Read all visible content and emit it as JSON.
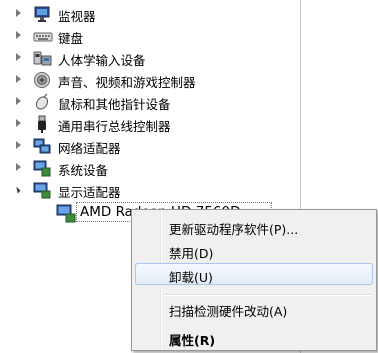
{
  "tree": {
    "items": [
      {
        "label": "监视器",
        "icon": "monitor-icon"
      },
      {
        "label": "键盘",
        "icon": "keyboard-icon"
      },
      {
        "label": "人体学输入设备",
        "icon": "hid-icon"
      },
      {
        "label": "声音、视频和游戏控制器",
        "icon": "speaker-icon"
      },
      {
        "label": "鼠标和其他指针设备",
        "icon": "mouse-icon"
      },
      {
        "label": "通用串行总线控制器",
        "icon": "usb-icon"
      },
      {
        "label": "网络适配器",
        "icon": "network-icon"
      },
      {
        "label": "系统设备",
        "icon": "system-device-icon"
      },
      {
        "label": "显示适配器",
        "icon": "display-adapter-icon"
      }
    ],
    "child": {
      "label": "AMD Radeon HD 7560D",
      "icon": "display-adapter-icon"
    }
  },
  "context_menu": {
    "items": [
      {
        "label": "更新驱动程序软件(P)..."
      },
      {
        "label": "禁用(D)"
      },
      {
        "label": "卸载(U)"
      },
      {
        "label": "扫描检测硬件改动(A)"
      },
      {
        "label": "属性(R)"
      }
    ]
  },
  "colors": {
    "menu_bg": "#f0f0f0",
    "menu_hover_border": "#a8c8ec",
    "menu_hover_fill": "#e2ecf7"
  }
}
